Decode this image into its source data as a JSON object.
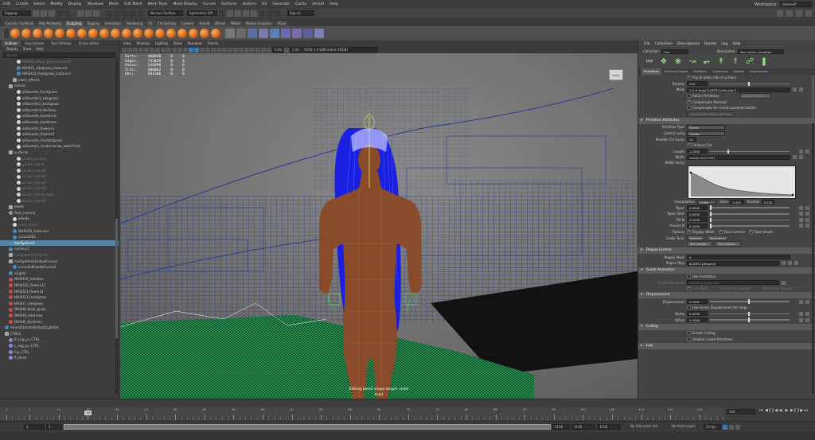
{
  "menubar": {
    "items": [
      "Edit",
      "Create",
      "Select",
      "Modify",
      "Display",
      "Windows",
      "Mesh",
      "Edit Mesh",
      "Mesh Tools",
      "Mesh Display",
      "Curves",
      "Surfaces",
      "Deform",
      "UV",
      "Generate",
      "Cache",
      "Arnold",
      "Help"
    ],
    "workspace_label": "Workspace:",
    "workspace_value": "General*"
  },
  "status_line": {
    "mode": "Rigging",
    "live_surface": "No Live Surface",
    "symmetry": "Symmetry: Off",
    "user": "Sign In"
  },
  "shelf": {
    "tabs": [
      "Curves / Surfaces",
      "Poly Modeling",
      "Sculpting",
      "Rigging",
      "Animation",
      "Rendering",
      "FX",
      "FX Caching",
      "Custom",
      "Arnold",
      "Bifrost",
      "MASH",
      "Motion Graphics",
      "XGen"
    ],
    "active_tab": "Sculpting"
  },
  "outliner": {
    "tabs": [
      "Outliner",
      "Hypershade",
      "Tool Settings",
      "Shape Editor"
    ],
    "menu": [
      "Display",
      "Show",
      "Help"
    ],
    "search_placeholder": "Search...",
    "items": [
      {
        "label": "MASH3_effect_grass_waterfall",
        "icon": "mesh-icon",
        "dim": true,
        "indent": 3
      },
      {
        "label": "MASH1_sidegrass_instancer",
        "icon": "mash-icon",
        "dim": false,
        "indent": 3
      },
      {
        "label": "MASH15_frontgrass_instancer",
        "icon": "mash-icon",
        "dim": false,
        "indent": 3
      },
      {
        "label": "plant_effects",
        "icon": "group-icon",
        "dim": false,
        "indent": 2
      },
      {
        "label": "islands",
        "icon": "group-icon",
        "dim": false,
        "indent": 1
      },
      {
        "label": "sdlisandm_frontgrass",
        "icon": "mesh-icon",
        "dim": false,
        "indent": 3
      },
      {
        "label": "sdlisandm1_sidegrass",
        "icon": "mesh-icon",
        "dim": false,
        "indent": 3
      },
      {
        "label": "sdlisandm1_backgrass",
        "icon": "mesh-icon",
        "dim": false,
        "indent": 3
      },
      {
        "label": "sdlisandm1sideTrees",
        "icon": "mesh-icon",
        "dim": false,
        "indent": 3
      },
      {
        "label": "sdlisandm_backtrees",
        "icon": "mesh-icon",
        "dim": false,
        "indent": 3
      },
      {
        "label": "sdlisandm_fronttrees",
        "icon": "mesh-icon",
        "dim": false,
        "indent": 3
      },
      {
        "label": "sdlisandm_flowers1",
        "icon": "mesh-icon",
        "dim": false,
        "indent": 3
      },
      {
        "label": "sdlisandm_flowers2",
        "icon": "mesh-icon",
        "dim": false,
        "indent": 3
      },
      {
        "label": "sdlisandm_frontbldgrass",
        "icon": "mesh-icon",
        "dim": false,
        "indent": 3
      },
      {
        "label": "sdlisandm_randomwnds_waterfront",
        "icon": "mesh-icon",
        "dim": false,
        "indent": 3
      },
      {
        "label": "surfaces",
        "icon": "group-icon",
        "dim": false,
        "indent": 1
      },
      {
        "label": "pCube_surface",
        "icon": "mesh-icon",
        "dim": true,
        "indent": 3
      },
      {
        "label": "pCube_island",
        "icon": "mesh-icon",
        "dim": true,
        "indent": 3
      },
      {
        "label": "pCube_island1",
        "icon": "mesh-icon",
        "dim": true,
        "indent": 3
      },
      {
        "label": "pCube_island2",
        "icon": "mesh-icon",
        "dim": true,
        "indent": 3
      },
      {
        "label": "pCube_island3",
        "icon": "mesh-icon",
        "dim": true,
        "indent": 3
      },
      {
        "label": "pCube_island4",
        "icon": "mesh-icon",
        "dim": true,
        "indent": 3
      },
      {
        "label": "pCube_island_edge",
        "icon": "mesh-icon",
        "dim": true,
        "indent": 3
      },
      {
        "label": "pCube_island5",
        "icon": "mesh-icon",
        "dim": true,
        "indent": 3
      },
      {
        "label": "seeds",
        "icon": "group-icon",
        "dim": false,
        "indent": 1
      },
      {
        "label": "final_camera",
        "icon": "camera-icon",
        "dim": false,
        "indent": 1
      },
      {
        "label": "albedo",
        "icon": "mesh-icon",
        "dim": false,
        "indent": 2
      },
      {
        "label": "plant_patch",
        "icon": "mesh-icon",
        "dim": true,
        "indent": 2
      },
      {
        "label": "MASH16_Instancer",
        "icon": "mash-icon",
        "dim": false,
        "indent": 2
      },
      {
        "label": "curve2001",
        "icon": "curve-icon",
        "dim": false,
        "indent": 2
      },
      {
        "label": "hairSystem1",
        "icon": "hair-icon",
        "dim": false,
        "indent": 1,
        "selected": true
      },
      {
        "label": "nucleus1",
        "icon": "nucleus-icon",
        "dim": false,
        "indent": 1
      },
      {
        "label": "hairSystem1Follicles",
        "icon": "group-icon",
        "dim": true,
        "indent": 1
      },
      {
        "label": "hairSystem1OutputCurves",
        "icon": "group-icon",
        "dim": false,
        "indent": 1
      },
      {
        "label": "curveShBrakdefCurve1",
        "icon": "curve-icon",
        "dim": false,
        "indent": 2
      },
      {
        "label": "xGgal1",
        "icon": "xgen-icon",
        "dim": false,
        "indent": 1
      },
      {
        "label": "MASH10_frontbee",
        "icon": "red-icon",
        "dim": false,
        "indent": 1
      },
      {
        "label": "MASH12_flowers12",
        "icon": "red-icon",
        "dim": false,
        "indent": 1
      },
      {
        "label": "MASH13_flowers2",
        "icon": "red-icon",
        "dim": false,
        "indent": 1
      },
      {
        "label": "MASH13_frontgrass",
        "icon": "red-icon",
        "dim": false,
        "indent": 1
      },
      {
        "label": "MASH7_sidegrass",
        "icon": "red-icon",
        "dim": false,
        "indent": 1
      },
      {
        "label": "MASH8_back_grass",
        "icon": "red-icon",
        "dim": false,
        "indent": 1
      },
      {
        "label": "MASH9_sidetrees",
        "icon": "red-icon",
        "dim": false,
        "indent": 1
      },
      {
        "label": "MASH6_backtree",
        "icon": "red-icon",
        "dim": false,
        "indent": 1
      },
      {
        "label": "ArnoldStandInDefaultLightSet",
        "icon": "light-icon",
        "dim": false,
        "indent": 0
      },
      {
        "label": "CTRLS",
        "icon": "group-icon",
        "dim": false,
        "indent": 0
      },
      {
        "label": "B_Leg_pv_CTRL",
        "icon": "control-icon",
        "dim": false,
        "indent": 1
      },
      {
        "label": "L_Leg_pv_CTRL",
        "icon": "control-icon",
        "dim": false,
        "indent": 1
      },
      {
        "label": "hip_CTRL",
        "icon": "control-icon",
        "dim": false,
        "indent": 1
      },
      {
        "label": "R_Wrist",
        "icon": "control-icon",
        "dim": false,
        "indent": 1
      }
    ]
  },
  "viewport": {
    "menu": [
      "View",
      "Shading",
      "Lighting",
      "Show",
      "Renderer",
      "Panels"
    ],
    "colorspace": "ACES 1.0 SDR-video (sRGB)",
    "exposure": "0.00",
    "gamma": "1.00",
    "hud": {
      "rows": [
        {
          "label": "Verts:",
          "a": "460948",
          "b": "0",
          "c": "0"
        },
        {
          "label": "Edges:",
          "a": "742829",
          "b": "0",
          "c": "0"
        },
        {
          "label": "Faces:",
          "a": "244096",
          "b": "0",
          "c": "0"
        },
        {
          "label": "Tris:",
          "a": "486862",
          "b": "0",
          "c": "0"
        },
        {
          "label": "UVs:",
          "a": "501208",
          "b": "0",
          "c": "0"
        }
      ]
    },
    "viewcube_label": "FRONT",
    "message_line1": "Editing blend shape target: smile",
    "message_line2": "front"
  },
  "attribute_editor": {
    "menu": [
      "File",
      "Collection",
      "Descriptions",
      "Guides",
      "Log",
      "Help"
    ],
    "collection_label": "Collection",
    "collection_value": "Hair",
    "description_label": "Description",
    "description_value": "description_headHair",
    "tabs": [
      "Primitives",
      "Preview/Output",
      "Modifiers",
      "Grooming",
      "Utilities",
      "Expressions"
    ],
    "active_tab": "Primitives",
    "top": {
      "flip_label": "Flip to other side of surface",
      "density_label": "Density",
      "density_value": "250",
      "mask_label": "Mask",
      "mask_value": "1.0 # map('${DESC}/density/')",
      "retain_label": "Retain Primitives",
      "specify_btn": "Specify Points...",
      "comp_normals_label": "Compensate Normals",
      "comp_screen_label": "Compensate for screen parametrization",
      "create_btn": "Create Secondary Hair Map"
    },
    "prim_attrs": {
      "title": "Primitive Attributes",
      "type_label": "Primitive Type",
      "type_value": "Spline",
      "control_label": "Control using",
      "control_value": "Guides",
      "cv_label": "Modifier CV Count",
      "cv_value": "15",
      "unitwidth_label": "Unitless CVs",
      "length_label": "Length",
      "length_value": "1.2000",
      "width_label": "Width",
      "width_value": "rand(0.007,0.02)",
      "widthramp_label": "Width Ramp",
      "interp_label": "Interpolation",
      "interp_value": "Linear",
      "value_label": "Value",
      "value_value": "1.000",
      "position_label": "Position",
      "position_value": "0.000",
      "taper_label": "Taper",
      "taper_value": "0.0000",
      "taperstart_label": "Taper Start",
      "taperstart_value": "0.0000",
      "tilts_label": "Tilt N",
      "tilts_value": "0.0000",
      "aroundn_label": "Around N",
      "aroundn_value": "0.0000",
      "options_label": "Options",
      "display_width_label": "Display Width",
      "face_camera_label": "Face Camera",
      "tube_shade_label": "Tube Shade",
      "guide_tools_label": "Guide Tools",
      "refresh_btn": "Refresh",
      "normalize_btn": "Normalize",
      "set_length_btn": "Set Length...",
      "set_ramp_btn": "Set Extend..."
    },
    "region_control": {
      "title": "Region Control",
      "mask_label": "Region Mask",
      "mask_value": "0",
      "map_label": "Region Map",
      "map_value": "${DESC}/Region/"
    },
    "guide_anim": {
      "title": "Guide Animation",
      "use_label": "Use Animation",
      "cache_label": "Cache File Name",
      "cache_value": "${DESC}/guide.abc",
      "live_mode_label": "Live Mode",
      "create_btn": "Create Hair System",
      "attach_btn": "Attach Hair System"
    },
    "displacement": {
      "title": "Displacement",
      "disp_label": "Displacement",
      "disp_value": "0.0000",
      "vector_label": "Use Vector Displacement for maps",
      "bump_label": "Bump",
      "bump_value": "0.0000",
      "offset_label": "Offset",
      "offset_value": "0.0000"
    },
    "culling": {
      "title": "Culling",
      "enable_label": "Enable Culling",
      "shadow_label": "Shadow Culled Primitives"
    },
    "log_title": "Log"
  },
  "timeline": {
    "labels": [
      "1",
      "5",
      "10",
      "15",
      "20",
      "25",
      "30",
      "35",
      "40",
      "45",
      "50",
      "55",
      "60",
      "65",
      "70",
      "75",
      "80",
      "85",
      "90",
      "95",
      "100",
      "105",
      "110",
      "115",
      "120"
    ],
    "current_frame": "15",
    "current_field": "144",
    "range_start": "1",
    "range_inner_start": "1",
    "range_end": "1100",
    "range_outer_end": "1100",
    "anim_end": "1100",
    "character_set": "No Character Set",
    "anim_layer": "No Anim Layer",
    "fps": "24 fps"
  },
  "colors": {
    "hair_blue": "#1a1fe0",
    "grass_green": "#3dea7d",
    "skin": "#8a4b2a",
    "wire_blue": "#1a2a7a",
    "selected_row": "#5285a6"
  }
}
